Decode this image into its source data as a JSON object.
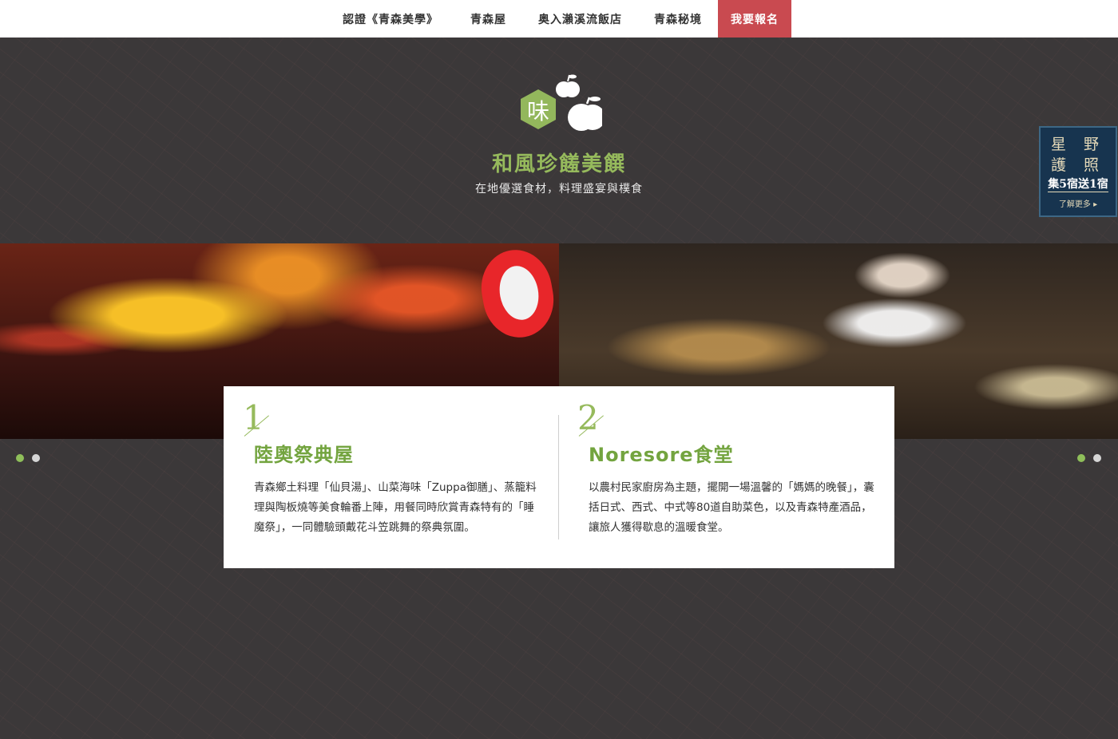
{
  "nav": {
    "items": [
      {
        "label": "認證《青森美學》"
      },
      {
        "label": "青森屋"
      },
      {
        "label": "奥入瀨溪流飯店"
      },
      {
        "label": "青森秘境"
      },
      {
        "label": "我要報名"
      }
    ]
  },
  "header": {
    "logo_char": "味",
    "title": "和風珍饈美饌",
    "subtitle": "在地優選食材，料理盛宴與樸食"
  },
  "passport": {
    "line1": "星 野",
    "line2": "護 照",
    "offer": "集5宿送1宿",
    "more": "了解更多 ▸"
  },
  "cards": [
    {
      "number": "1",
      "title": "陸奧祭典屋",
      "text": "青森鄉土料理「仙貝湯」、山菜海味「Zuppa御膳」、蒸籠料理與陶板燒等美食輪番上陣，用餐同時欣賞青森特有的「睡魔祭」，一同體驗頭戴花斗笠跳舞的祭典氛圍。"
    },
    {
      "number": "2",
      "title": "Noresore食堂",
      "text": "以農村民家廚房為主題，擺開一場溫馨的「媽媽的晚餐」，囊括日式、西式、中式等80道自助菜色，以及青森特產酒品，讓旅人獲得歇息的溫暖食堂。"
    }
  ],
  "colors": {
    "accent_green": "#96ba5c",
    "cta_red": "#c94a50",
    "passport_navy": "#17344f",
    "background": "#3b3839"
  }
}
